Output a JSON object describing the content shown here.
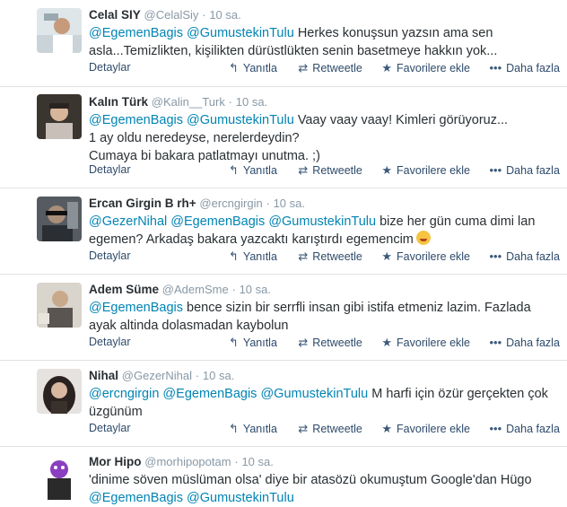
{
  "actions": {
    "details": "Detaylar",
    "reply": "Yanıtla",
    "retweet": "Retweetle",
    "favorite": "Favorilere ekle",
    "more": "Daha fazla"
  },
  "icons": {
    "reply": "reply-arrow-icon",
    "retweet": "retweet-icon",
    "favorite": "star-icon",
    "more": "three-dots-icon"
  },
  "colors": {
    "mention": "#0084b4",
    "meta": "#8899a6",
    "action": "#2d4a6a"
  },
  "tweets": [
    {
      "name": "Celal SIY",
      "handle": "@CelalSiy",
      "sep": "·",
      "time": "10 sa.",
      "mentions": [
        "@EgemenBagis",
        "@GumustekinTulu"
      ],
      "text_after": " Herkes konuşsun yazsın ama sen",
      "lines": [
        "asla...Temizlikten, kişilikten dürüstlükten senin basetmeye hakkın yok..."
      ]
    },
    {
      "name": "Kalın Türk",
      "handle": "@Kalin__Turk",
      "sep": "·",
      "time": "10 sa.",
      "mentions": [
        "@EgemenBagis",
        "@GumustekinTulu"
      ],
      "text_after": " Vaay vaay vaay! Kimleri görüyoruz...",
      "lines": [
        "1 ay oldu neredeyse, nerelerdeydin?",
        "Cumaya bi bakara patlatmayı unutma. ;)"
      ]
    },
    {
      "name": "Ercan Girgin B rh+",
      "handle": "@ercngirgin",
      "sep": "·",
      "time": "10 sa.",
      "mentions": [
        "@GezerNihal",
        "@EgemenBagis",
        "@GumustekinTulu"
      ],
      "text_after": " bize her gün cuma dimi lan",
      "lines": [
        "egemen? Arkadaş bakara yazcaktı karıştırdı egemencim"
      ]
    },
    {
      "name": "Adem Süme",
      "handle": "@AdemSme",
      "sep": "·",
      "time": "10 sa.",
      "mentions": [
        "@EgemenBagis"
      ],
      "text_after": " bence sizin bir serrfli insan gibi istifa etmeniz lazim. Fazlada",
      "lines": [
        "ayak altinda dolasmadan kaybolun"
      ]
    },
    {
      "name": "Nihal",
      "handle": "@GezerNihal",
      "sep": "·",
      "time": "10 sa.",
      "mentions": [
        "@ercngirgin",
        "@EgemenBagis",
        "@GumustekinTulu"
      ],
      "text_after": " M harfi için özür gerçekten çok",
      "lines": [
        "üzgünüm"
      ]
    },
    {
      "name": "Mor Hipo",
      "handle": "@morhipopotam",
      "sep": "·",
      "time": "10 sa.",
      "mentions": [],
      "text_after": "'dinime söven müslüman olsa'  diye bir atasözü okumuştum Google'dan Hügo",
      "lines": [],
      "tail_mentions": [
        "@EgemenBagis",
        "@GumustekinTulu"
      ]
    }
  ]
}
